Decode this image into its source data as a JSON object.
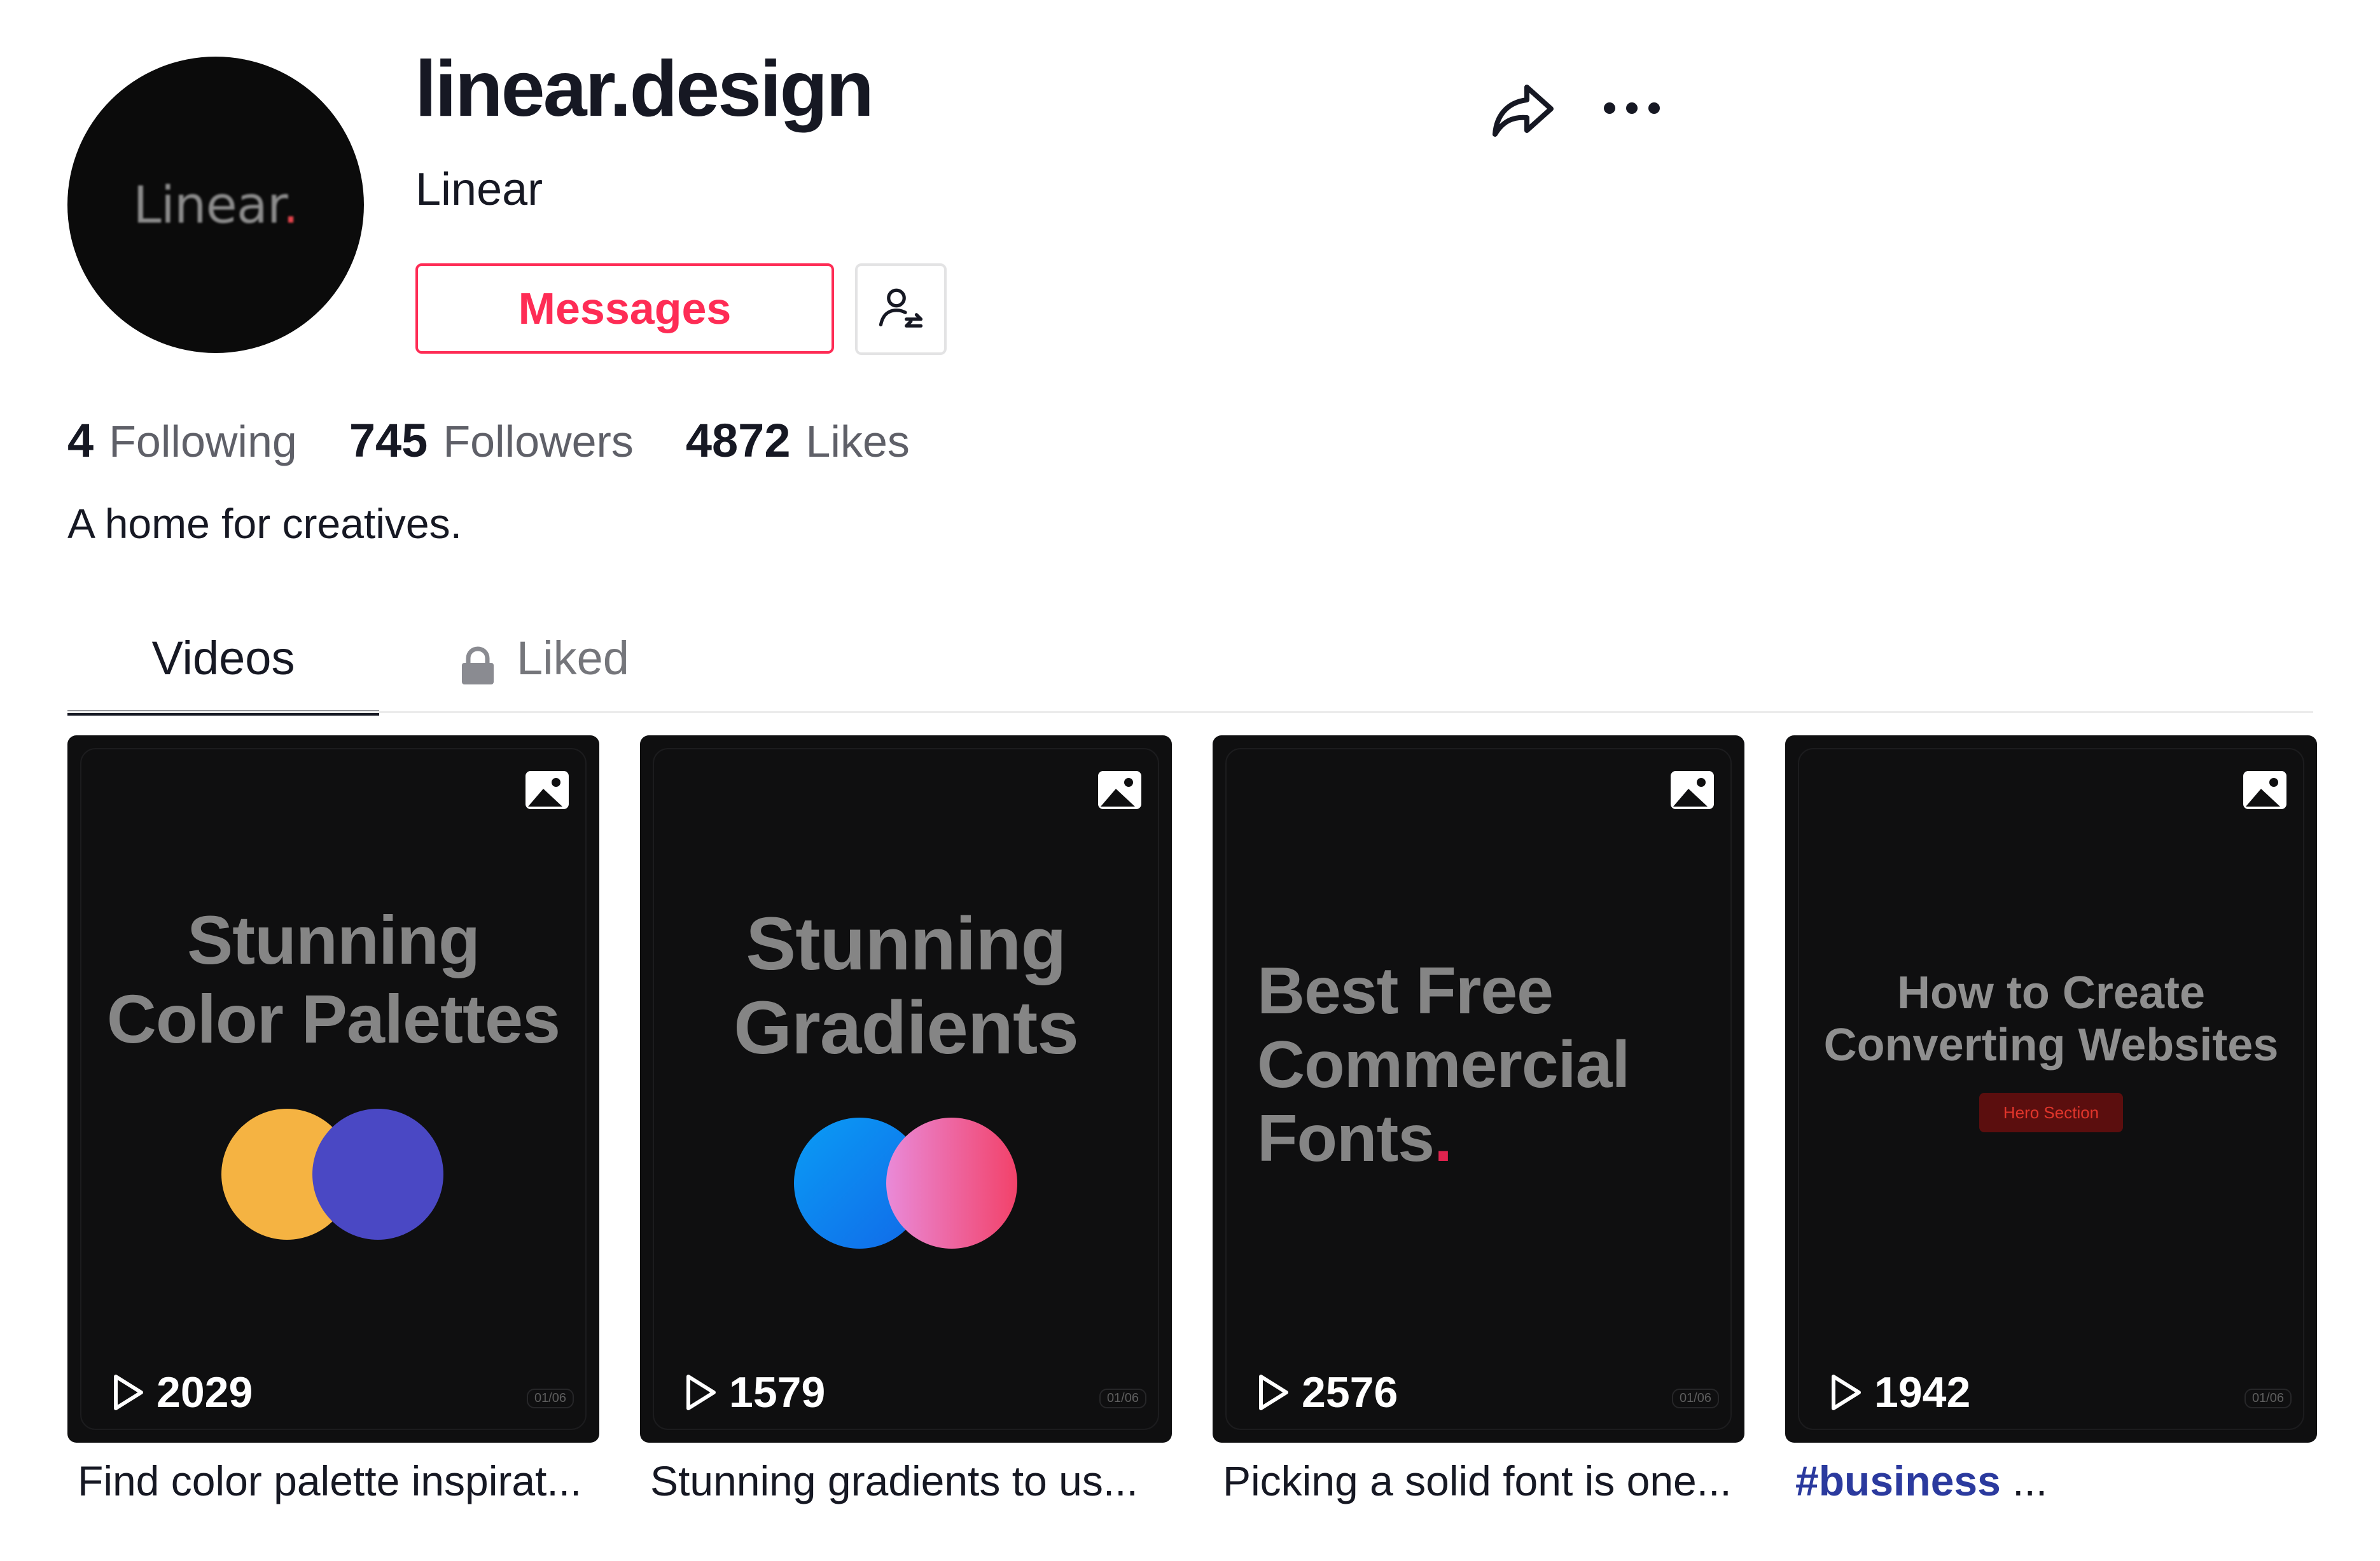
{
  "profile": {
    "avatar_text": "Linear",
    "avatar_dot": ".",
    "username": "linear.design",
    "nickname": "Linear",
    "messages_label": "Messages",
    "bio": "A home for creatives."
  },
  "stats": [
    {
      "value": "4",
      "label": "Following"
    },
    {
      "value": "745",
      "label": "Followers"
    },
    {
      "value": "4872",
      "label": "Likes"
    }
  ],
  "tabs": {
    "videos": "Videos",
    "liked": "Liked"
  },
  "videos": [
    {
      "title_lines": [
        "Stunning",
        "Color Palettes"
      ],
      "views": "2029",
      "pager": "01/06",
      "caption": "Find color palette inspirat..."
    },
    {
      "title_lines": [
        "Stunning",
        "Gradients"
      ],
      "views": "1579",
      "pager": "01/06",
      "caption": "Stunning gradients to us..."
    },
    {
      "title_lines": [
        "Best Free",
        "Commercial",
        "Fonts"
      ],
      "title_dot": ".",
      "views": "2576",
      "pager": "01/06",
      "caption": "Picking a solid font is one..."
    },
    {
      "title_lines": [
        "How to Create",
        "Converting Websites"
      ],
      "badge": "Hero Section",
      "views": "1942",
      "pager": "01/06",
      "caption_tag": "#business",
      "caption_suffix": " ..."
    }
  ],
  "colors": {
    "accent": "#fe2c55",
    "card_bg": "#0f0f10",
    "palette_orange": "#f5b342",
    "palette_indigo": "#4a48c4",
    "gradient_blue": "#0a8ff5",
    "gradient_pink": "#f06aa8",
    "red_dot": "#e0234e"
  },
  "icons": [
    "share-icon",
    "more-icon",
    "follow-switch-icon",
    "lock-icon",
    "photo-icon",
    "play-icon"
  ]
}
